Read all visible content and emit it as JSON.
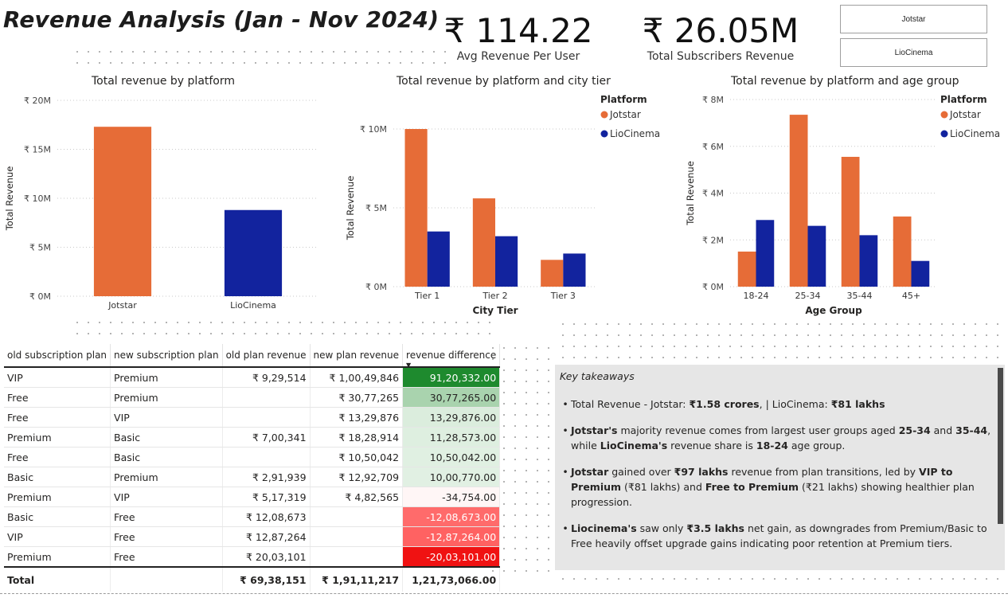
{
  "title": "Revenue Analysis (Jan - Nov 2024)",
  "kpis": {
    "arpu": {
      "value": "₹ 114.22",
      "label": "Avg Revenue Per User"
    },
    "subs_revenue": {
      "value": "₹ 26.05M",
      "label": "Total Subscribers Revenue"
    }
  },
  "slicer": {
    "options": [
      "Jotstar",
      "LioCinema"
    ]
  },
  "colors": {
    "jotstar": "#E66C37",
    "liocinema": "#12239E",
    "gridline": "#c8c8c8",
    "panel": "#e6e6e6"
  },
  "chart_data": [
    {
      "type": "bar",
      "title": "Total revenue by platform",
      "ylabel": "Total Revenue",
      "xlabel": "",
      "categories": [
        "Jotstar",
        "LioCinema"
      ],
      "values": [
        17300000,
        8800000
      ],
      "bar_colors": [
        "#E66C37",
        "#12239E"
      ],
      "ylim": [
        0,
        20000000
      ],
      "yticks": [
        "₹ 0M",
        "₹ 5M",
        "₹ 10M",
        "₹ 15M",
        "₹ 20M"
      ],
      "grid": true
    },
    {
      "type": "bar",
      "title": "Total revenue by platform and city tier",
      "xlabel": "City Tier",
      "ylabel": "Total Revenue",
      "categories": [
        "Tier 1",
        "Tier 2",
        "Tier 3"
      ],
      "series": [
        {
          "name": "Jotstar",
          "values": [
            10000000,
            5600000,
            1700000
          ],
          "color": "#E66C37"
        },
        {
          "name": "LioCinema",
          "values": [
            3500000,
            3200000,
            2100000
          ],
          "color": "#12239E"
        }
      ],
      "ylim": [
        0,
        10000000
      ],
      "yticks": [
        "₹ 0M",
        "₹ 5M",
        "₹ 10M"
      ],
      "legend": {
        "title": "Platform",
        "position": "top-right"
      },
      "grid": true
    },
    {
      "type": "bar",
      "title": "Total revenue by platform and age group",
      "xlabel": "Age Group",
      "ylabel": "Total Revenue",
      "categories": [
        "18-24",
        "25-34",
        "35-44",
        "45+"
      ],
      "series": [
        {
          "name": "Jotstar",
          "values": [
            1500000,
            7350000,
            5550000,
            3000000
          ],
          "color": "#E66C37"
        },
        {
          "name": "LioCinema",
          "values": [
            2850000,
            2600000,
            2200000,
            1100000
          ],
          "color": "#12239E"
        }
      ],
      "ylim": [
        0,
        8000000
      ],
      "yticks": [
        "₹ 0M",
        "₹ 2M",
        "₹ 4M",
        "₹ 6M",
        "₹ 8M"
      ],
      "legend": {
        "title": "Platform",
        "position": "top-right"
      },
      "grid": true
    }
  ],
  "table": {
    "columns": [
      "old subscription plan",
      "new subscription plan",
      "old plan revenue",
      "new plan revenue",
      "revenue difference"
    ],
    "sort_indicator": "▼",
    "rows": [
      {
        "old": "VIP",
        "new": "Premium",
        "old_rev": "₹ 9,29,514",
        "new_rev": "₹ 1,00,49,846",
        "diff": "91,20,332.00",
        "bg": "#1e8a2e",
        "fg": "#ffffff"
      },
      {
        "old": "Free",
        "new": "Premium",
        "old_rev": "",
        "new_rev": "₹ 30,77,265",
        "diff": "30,77,265.00",
        "bg": "#a9d3ae",
        "fg": "#252423"
      },
      {
        "old": "Free",
        "new": "VIP",
        "old_rev": "",
        "new_rev": "₹ 13,29,876",
        "diff": "13,29,876.00",
        "bg": "#dbeddd",
        "fg": "#252423"
      },
      {
        "old": "Premium",
        "new": "Basic",
        "old_rev": "₹ 7,00,341",
        "new_rev": "₹ 18,28,914",
        "diff": "11,28,573.00",
        "bg": "#deefe0",
        "fg": "#252423"
      },
      {
        "old": "Free",
        "new": "Basic",
        "old_rev": "",
        "new_rev": "₹ 10,50,042",
        "diff": "10,50,042.00",
        "bg": "#e0f0e2",
        "fg": "#252423"
      },
      {
        "old": "Basic",
        "new": "Premium",
        "old_rev": "₹ 2,91,939",
        "new_rev": "₹ 12,92,709",
        "diff": "10,00,770.00",
        "bg": "#e1f0e3",
        "fg": "#252423"
      },
      {
        "old": "Premium",
        "new": "VIP",
        "old_rev": "₹ 5,17,319",
        "new_rev": "₹ 4,82,565",
        "diff": "-34,754.00",
        "bg": "#fff6f6",
        "fg": "#252423"
      },
      {
        "old": "Basic",
        "new": "Free",
        "old_rev": "₹ 12,08,673",
        "new_rev": "",
        "diff": "-12,08,673.00",
        "bg": "#ff6b6b",
        "fg": "#ffffff"
      },
      {
        "old": "VIP",
        "new": "Free",
        "old_rev": "₹ 12,87,264",
        "new_rev": "",
        "diff": "-12,87,264.00",
        "bg": "#ff6262",
        "fg": "#ffffff"
      },
      {
        "old": "Premium",
        "new": "Free",
        "old_rev": "₹ 20,03,101",
        "new_rev": "",
        "diff": "-20,03,101.00",
        "bg": "#f01212",
        "fg": "#ffffff"
      }
    ],
    "total": {
      "label": "Total",
      "new": "",
      "old_rev": "₹ 69,38,151",
      "new_rev": "₹ 1,91,11,217",
      "diff": "1,21,73,066.00"
    }
  },
  "takeaways": {
    "title": "Key takeaways",
    "items": [
      [
        {
          "t": "Total Revenue - Jotstar: "
        },
        {
          "t": "₹1.58 crores",
          "b": true
        },
        {
          "t": ", | LioCinema: "
        },
        {
          "t": "₹81 lakhs",
          "b": true
        }
      ],
      [
        {
          "t": "Jotstar's",
          "b": true
        },
        {
          "t": " majority revenue comes from largest user groups aged "
        },
        {
          "t": "25-34",
          "b": true
        },
        {
          "t": " and "
        },
        {
          "t": "35-44",
          "b": true
        },
        {
          "t": ", while "
        },
        {
          "t": "LioCinema's",
          "b": true
        },
        {
          "t": " revenue share is "
        },
        {
          "t": "18-24",
          "b": true
        },
        {
          "t": " age group."
        }
      ],
      [
        {
          "t": "Jotstar",
          "b": true
        },
        {
          "t": " gained over "
        },
        {
          "t": "₹97 lakhs",
          "b": true
        },
        {
          "t": " revenue from plan transitions, led by "
        },
        {
          "t": "VIP to Premium",
          "b": true
        },
        {
          "t": " (₹81 lakhs) and "
        },
        {
          "t": "Free to Premium",
          "b": true
        },
        {
          "t": " (₹21 lakhs) showing healthier plan progression."
        }
      ],
      [
        {
          "t": "Liocinema's",
          "b": true
        },
        {
          "t": " saw only "
        },
        {
          "t": "₹3.5 lakhs",
          "b": true
        },
        {
          "t": " net gain, as downgrades from Premium/Basic to Free heavily offset upgrade gains indicating poor retention at Premium tiers."
        }
      ]
    ]
  }
}
